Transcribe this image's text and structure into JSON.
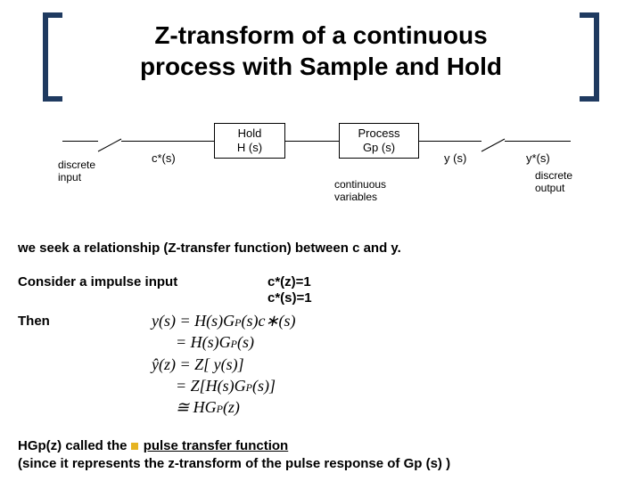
{
  "title_l1": "Z-transform of a continuous",
  "title_l2": "process with Sample and Hold",
  "diagram": {
    "hold_l1": "Hold",
    "hold_l2": "H (s)",
    "proc_l1": "Process",
    "proc_l2": "Gp (s)",
    "discrete_in_l1": "discrete",
    "discrete_in_l2": "input",
    "c_star": "c*(s)",
    "y_s": "y (s)",
    "y_star": "y*(s)",
    "cont_vars_l1": "continuous",
    "cont_vars_l2": "variables",
    "discrete_out_l1": "discrete",
    "discrete_out_l2": "output"
  },
  "body": {
    "seek_rel": "we seek a relationship (Z-transfer function)  between c and y.",
    "consider": "Consider a impulse input",
    "impulse_z": "c*(z)=1",
    "impulse_s": "c*(s)=1",
    "then": "Then",
    "final_pre": "HGp(z) called the ",
    "final_u": "pulse  transfer function",
    "final2": "(since it represents the z-transform of the pulse response of Gp (s) )"
  }
}
